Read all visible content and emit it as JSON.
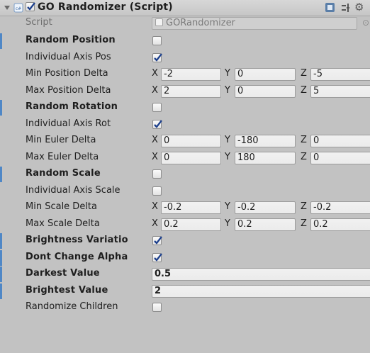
{
  "component": {
    "title": "GO Randomizer (Script)",
    "script_label": "Script",
    "script_value": "GORandomizer",
    "axis": {
      "x": "X",
      "y": "Y",
      "z": "Z"
    }
  },
  "rows": [
    {
      "label": "Random Position",
      "bold": true,
      "checked": false
    },
    {
      "label": "Individual Axis Pos",
      "checked": true
    },
    {
      "label": "Min Position Delta",
      "x": "-2",
      "y": "0",
      "z": "-5"
    },
    {
      "label": "Max Position Delta",
      "x": "2",
      "y": "0",
      "z": "5"
    },
    {
      "label": "Random Rotation",
      "bold": true,
      "checked": false
    },
    {
      "label": "Individual Axis Rot",
      "checked": true
    },
    {
      "label": "Min Euler Delta",
      "x": "0",
      "y": "-180",
      "z": "0"
    },
    {
      "label": "Max Euler Delta",
      "x": "0",
      "y": "180",
      "z": "0"
    },
    {
      "label": "Random Scale",
      "bold": true,
      "checked": false
    },
    {
      "label": "Individual Axis Scale",
      "checked": false
    },
    {
      "label": "Min Scale Delta",
      "x": "-0.2",
      "y": "-0.2",
      "z": "-0.2"
    },
    {
      "label": "Max Scale Delta",
      "x": "0.2",
      "y": "0.2",
      "z": "0.2"
    },
    {
      "label": "Brightness Variatio",
      "bold": true,
      "checked": true
    },
    {
      "label": "Dont Change Alpha",
      "bold": true,
      "checked": true
    },
    {
      "label": "Darkest Value",
      "bold": true,
      "value": "0.5"
    },
    {
      "label": "Brightest Value",
      "bold": true,
      "value": "2"
    },
    {
      "label": "Randomize Children",
      "checked": false
    }
  ],
  "colors": {
    "modified_marker": "#4f87c6",
    "check": "#1c3f8c"
  }
}
